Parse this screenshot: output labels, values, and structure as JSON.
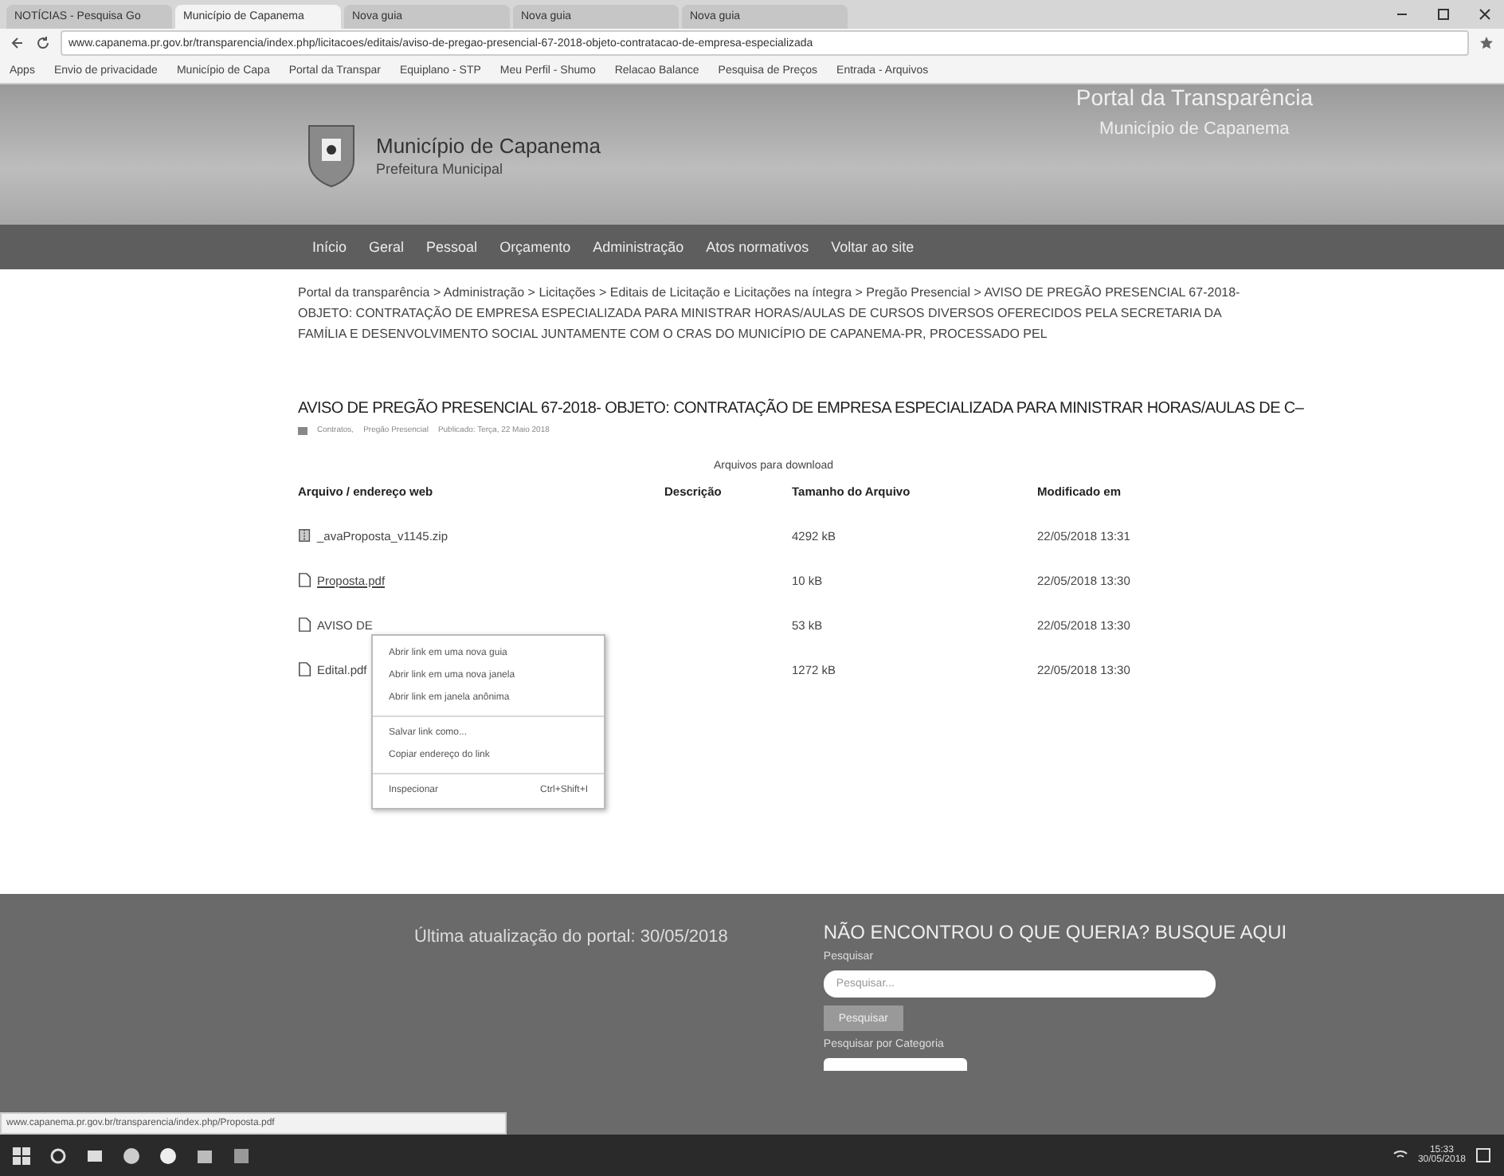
{
  "browser": {
    "tabs": [
      {
        "label": "NOTÍCIAS - Pesquisa Go",
        "selected": false
      },
      {
        "label": "Município de Capanema",
        "selected": true
      },
      {
        "label": "Nova guia",
        "selected": false
      },
      {
        "label": "Nova guia",
        "selected": false
      },
      {
        "label": "Nova guia",
        "selected": false
      }
    ],
    "address": "www.capanema.pr.gov.br/transparencia/index.php/licitacoes/editais/aviso-de-pregao-presencial-67-2018-objeto-contratacao-de-empresa-especializada",
    "bookmarks": [
      "Apps",
      "Envio de privacidade",
      "Município de Capa",
      "Portal da Transpar",
      "Equiplano - STP",
      "Meu Perfil - Shumo",
      "Relacao Balance",
      "Pesquisa de Preços",
      "Entrada - Arquivos"
    ]
  },
  "header": {
    "title": "Município de Capanema",
    "subtitle": "Prefeitura Municipal",
    "portal_title": "Portal da Transparência",
    "portal_subtitle": "Município de Capanema"
  },
  "nav": [
    {
      "label": "Início"
    },
    {
      "label": "Geral"
    },
    {
      "label": "Pessoal"
    },
    {
      "label": "Orçamento"
    },
    {
      "label": "Administração"
    },
    {
      "label": "Atos normativos"
    },
    {
      "label": "Voltar ao site"
    }
  ],
  "breadcrumb": "Portal da transparência > Administração > Licitações > Editais de Licitação e Licitações na íntegra > Pregão Presencial > AVISO DE PREGÃO PRESENCIAL 67-2018- OBJETO: CONTRATAÇÃO DE EMPRESA ESPECIALIZADA PARA MINISTRAR HORAS/AULAS DE CURSOS DIVERSOS OFERECIDOS PELA SECRETARIA DA FAMÍLIA E DESENVOLVIMENTO SOCIAL JUNTAMENTE COM O CRAS DO MUNICÍPIO DE CAPANEMA-PR, PROCESSADO PEL",
  "article": {
    "title": "AVISO DE PREGÃO PRESENCIAL 67-2018- OBJETO: CONTRATAÇÃO DE EMPRESA ESPECIALIZADA PARA MINISTRAR HORAS/AULAS DE C–",
    "meta": [
      "Contratos,",
      "Pregão Presencial",
      "Publicado: Terça, 22 Maio 2018"
    ],
    "caption": "Arquivos para download",
    "columns": [
      "Arquivo / endereço web",
      "Descrição",
      "Tamanho do Arquivo",
      "Modificado em"
    ],
    "rows": [
      {
        "file": "_avaProposta_v1145.zip",
        "kind": "zip",
        "size": "4292 kB",
        "modified": "22/05/2018 13:31"
      },
      {
        "file": "Proposta.pdf",
        "kind": "pdf",
        "size": "10 kB",
        "modified": "22/05/2018 13:30"
      },
      {
        "file": "AVISO DE",
        "kind": "pdf",
        "size": "53 kB",
        "modified": "22/05/2018 13:30"
      },
      {
        "file": "Edital.pdf",
        "kind": "pdf",
        "size": "1272 kB",
        "modified": "22/05/2018 13:30"
      }
    ]
  },
  "context_menu": {
    "items": [
      {
        "label": "Abrir link em uma nova guia",
        "separator_before": false
      },
      {
        "label": "Abrir link em uma nova janela",
        "separator_before": false
      },
      {
        "label": "Abrir link em janela anônima",
        "separator_before": false
      },
      {
        "label": "Salvar link como...",
        "separator_before": true
      },
      {
        "label": "Copiar endereço do link",
        "separator_before": false
      },
      {
        "label": "Inspecionar",
        "shortcut": "Ctrl+Shift+I",
        "separator_before": true
      }
    ]
  },
  "footer": {
    "updated": "Última atualização do portal: 30/05/2018",
    "search_heading": "NÃO ENCONTROU O QUE QUERIA? BUSQUE AQUI",
    "search_label": "Pesquisar",
    "search_placeholder": "Pesquisar...",
    "search_button": "Pesquisar",
    "category_label": "Pesquisar por Categoria"
  },
  "status_url": "www.capanema.pr.gov.br/transparencia/index.php/Proposta.pdf",
  "taskbar": {
    "time": "15:33",
    "date": "30/05/2018"
  }
}
